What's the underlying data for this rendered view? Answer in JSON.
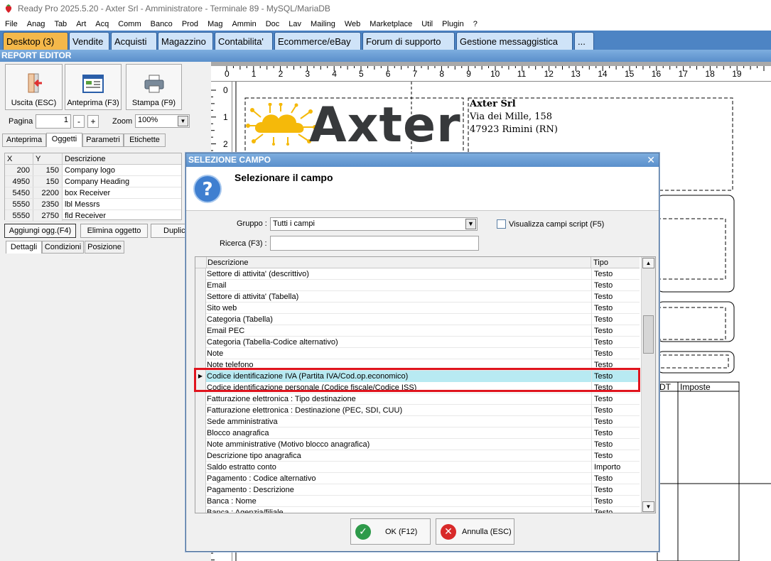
{
  "window": {
    "title": "Ready Pro 2025.5.20 - Axter Srl - Amministratore - Terminale 89 - MySQL/MariaDB"
  },
  "menu": [
    "File",
    "Anag",
    "Tab",
    "Art",
    "Acq",
    "Comm",
    "Banco",
    "Prod",
    "Mag",
    "Ammin",
    "Doc",
    "Lav",
    "Mailing",
    "Web",
    "Marketplace",
    "Util",
    "Plugin",
    "?"
  ],
  "module_tabs": [
    "Desktop (3)",
    "Vendite",
    "Acquisti",
    "Magazzino",
    "Contabilita'",
    "Ecommerce/eBay",
    "Forum di supporto",
    "Gestione messaggistica",
    "..."
  ],
  "report_editor": {
    "header": "REPORT EDITOR",
    "toolbar": {
      "exit": "Uscita (ESC)",
      "preview": "Anteprima (F3)",
      "print": "Stampa (F9)"
    },
    "page_label": "Pagina",
    "page_value": "1",
    "minus": "-",
    "plus": "+",
    "zoom_label": "Zoom",
    "zoom_value": "100%",
    "tabs": [
      "Anteprima",
      "Oggetti",
      "Parametri",
      "Etichette"
    ],
    "objects": {
      "headers": [
        "X",
        "Y",
        "Descrizione"
      ],
      "rows": [
        [
          "200",
          "150",
          "Company logo"
        ],
        [
          "4950",
          "150",
          "Company Heading"
        ],
        [
          "5450",
          "2200",
          "box Receiver"
        ],
        [
          "5550",
          "2350",
          "lbl Messrs"
        ],
        [
          "5550",
          "2750",
          "fld Receiver"
        ]
      ]
    },
    "actions": {
      "add": "Aggiungi ogg.(F4)",
      "delete": "Elimina oggetto",
      "duplicate": "Duplica"
    },
    "detail_tabs": [
      "Dettagli",
      "Condizioni",
      "Posizione"
    ]
  },
  "canvas": {
    "hruler": [
      "0",
      "1",
      "2",
      "3",
      "4",
      "5",
      "6",
      "7",
      "8",
      "9",
      "10",
      "11",
      "12",
      "13",
      "14",
      "15",
      "16",
      "17",
      "18",
      "19"
    ],
    "vruler": [
      "0",
      "1",
      "2"
    ],
    "company": {
      "logo_text": "Axter",
      "name": "Axter Srl",
      "address": "Via dei Mille, 158",
      "city": "47923 Rimini (RN)"
    },
    "table_headers": [
      "DT",
      "Imposte"
    ]
  },
  "dialog": {
    "title": "SELEZIONE CAMPO",
    "heading": "Selezionare il campo",
    "group_label": "Gruppo :",
    "group_value": "Tutti i campi",
    "show_script_label": "Visualizza campi script (F5)",
    "search_label": "Ricerca (F3) :",
    "columns": [
      "Descrizione",
      "Tipo"
    ],
    "rows": [
      [
        "Settore di attivita' (descrittivo)",
        "Testo"
      ],
      [
        "Email",
        "Testo"
      ],
      [
        "Settore di attivita' (Tabella)",
        "Testo"
      ],
      [
        "Sito web",
        "Testo"
      ],
      [
        "Categoria (Tabella)",
        "Testo"
      ],
      [
        "Email PEC",
        "Testo"
      ],
      [
        "Categoria (Tabella-Codice alternativo)",
        "Testo"
      ],
      [
        "Note",
        "Testo"
      ],
      [
        "Note telefono",
        "Testo"
      ],
      [
        "Codice identificazione IVA (Partita IVA/Cod.op.economico)",
        "Testo"
      ],
      [
        "Codice identificazione personale (Codice fiscale/Codice ISS)",
        "Testo"
      ],
      [
        "Fatturazione elettronica : Tipo destinazione",
        "Testo"
      ],
      [
        "Fatturazione elettronica : Destinazione (PEC, SDI, CUU)",
        "Testo"
      ],
      [
        "Sede amministrativa",
        "Testo"
      ],
      [
        "Blocco anagrafica",
        "Testo"
      ],
      [
        "Note amministrative (Motivo blocco anagrafica)",
        "Testo"
      ],
      [
        "Descrizione tipo anagrafica",
        "Testo"
      ],
      [
        "Saldo estratto conto",
        "Importo"
      ],
      [
        "Pagamento : Codice alternativo",
        "Testo"
      ],
      [
        "Pagamento : Descrizione",
        "Testo"
      ],
      [
        "Banca : Nome",
        "Testo"
      ],
      [
        "Banca : Agenzia/filiale",
        "Testo"
      ]
    ],
    "selected_index": 9,
    "ok": "OK (F12)",
    "cancel": "Annulla (ESC)"
  }
}
